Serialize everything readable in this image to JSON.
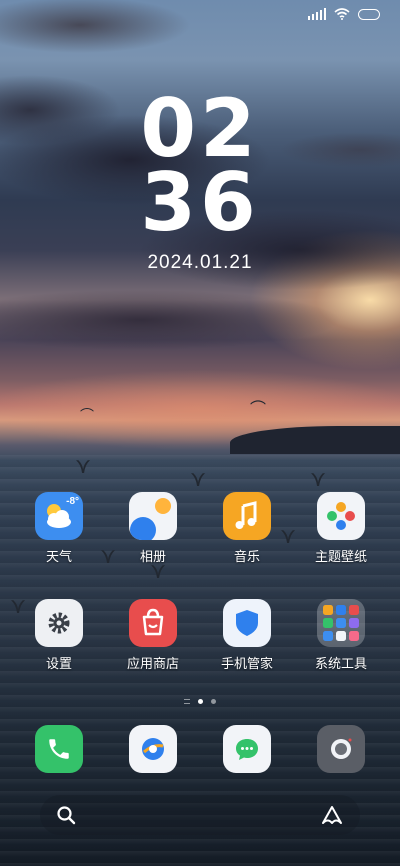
{
  "status_bar": {
    "signal_icon": "signal-icon",
    "wifi_icon": "wifi-icon",
    "battery_icon": "battery-icon"
  },
  "clock": {
    "hours": "02",
    "minutes": "36",
    "date": "2024.01.21"
  },
  "apps": [
    {
      "name": "天气",
      "icon": "weather-icon",
      "badge": "-8°",
      "color": "#3d8ef0"
    },
    {
      "name": "相册",
      "icon": "gallery-icon",
      "color": "#f2f4f8"
    },
    {
      "name": "音乐",
      "icon": "music-icon",
      "color": "#f6a623"
    },
    {
      "name": "主题壁纸",
      "icon": "themes-icon",
      "color": "#f2f4f8"
    },
    {
      "name": "设置",
      "icon": "settings-icon",
      "color": "#eef0f3"
    },
    {
      "name": "应用商店",
      "icon": "app-store-icon",
      "color": "#e84d4d"
    },
    {
      "name": "手机管家",
      "icon": "security-icon",
      "color": "#eef3fb"
    },
    {
      "name": "系统工具",
      "icon": "folder-icon",
      "color": "rgba(255,255,255,0.25)"
    }
  ],
  "page_indicator": {
    "pages": 2,
    "active": 1
  },
  "dock": [
    {
      "icon": "phone-icon",
      "color": "#34c26a"
    },
    {
      "icon": "browser-icon",
      "color": "#f2f4f8"
    },
    {
      "icon": "messages-icon",
      "color": "#f2f4f8"
    },
    {
      "icon": "camera-icon",
      "color": "#5a5e66"
    }
  ],
  "search_bar": {
    "search_icon": "search-icon",
    "assistant_icon": "assistant-icon"
  }
}
